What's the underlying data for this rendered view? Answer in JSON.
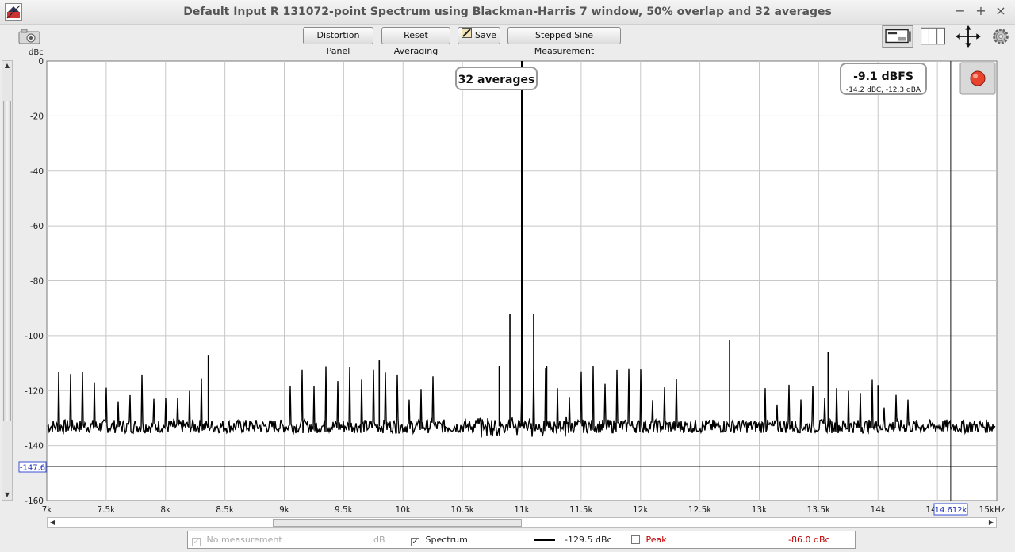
{
  "window": {
    "title": "Default Input R 131072-point Spectrum using Blackman-Harris 7 window, 50% overlap and 32 averages",
    "minimize": "−",
    "maximize": "+",
    "close": "×"
  },
  "toolbar": {
    "distortion_panel": "Distortion Panel",
    "reset_averaging": "Reset Averaging",
    "save": "Save",
    "stepped_sine": "Stepped Sine Measurement"
  },
  "y_unit": "dBc",
  "overlay": {
    "averages_label": "32 averages",
    "level_main": "-9.1 dBFS",
    "level_sub": "-14.2 dBC, -12.3 dBA",
    "cursor_y_value": "-147.6",
    "cursor_x_value": "14.612k"
  },
  "legend": {
    "no_measurement": "No measurement",
    "no_measurement_unit": "dB",
    "spectrum": "Spectrum",
    "spectrum_value": "-129.5 dBc",
    "peak": "Peak",
    "peak_value": "-86.0 dBc",
    "spectrum_color": "#000000",
    "peak_color": "#c00000"
  },
  "chart_data": {
    "type": "line",
    "title": "",
    "xlabel": "",
    "ylabel": "dBc",
    "xlim": [
      7000,
      15000
    ],
    "ylim": [
      -160,
      0
    ],
    "x_ticks": [
      "7k",
      "7.5k",
      "8k",
      "8.5k",
      "9k",
      "9.5k",
      "10k",
      "10.5k",
      "11k",
      "11.5k",
      "12k",
      "12.5k",
      "13k",
      "13.5k",
      "14k",
      "14.5k",
      "15kHz"
    ],
    "y_ticks": [
      "0",
      "-20",
      "-40",
      "-60",
      "-80",
      "-100",
      "-120",
      "-140",
      "-160"
    ],
    "grid": true,
    "noise_floor_db": -133,
    "fundamental": {
      "x": 11000,
      "y": 0
    },
    "peaks": [
      {
        "x": 10900,
        "y": -92
      },
      {
        "x": 11100,
        "y": -92
      },
      {
        "x": 12750,
        "y": -101.5
      },
      {
        "x": 13580,
        "y": -106
      },
      {
        "x": 14000,
        "y": -118
      },
      {
        "x": 8360,
        "y": -107
      },
      {
        "x": 9800,
        "y": -109
      },
      {
        "x": 10810,
        "y": -111
      },
      {
        "x": 11210,
        "y": -111
      }
    ],
    "series": [
      {
        "name": "Spectrum",
        "color": "#000000"
      }
    ],
    "cursor": {
      "x": 14612,
      "y": -147.6
    }
  }
}
